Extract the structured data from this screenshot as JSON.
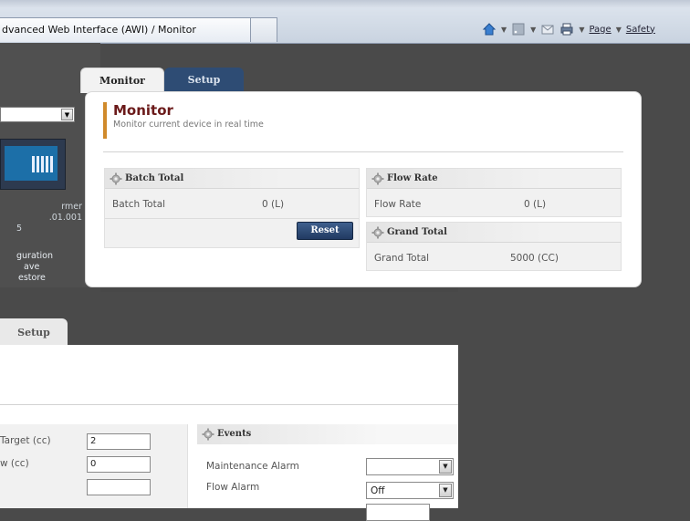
{
  "browser": {
    "tab_title": "dvanced Web Interface (AWI) / Monitor",
    "cmd_page": "Page",
    "cmd_safety": "Safety"
  },
  "left_window": {
    "lines": [
      "rmer",
      ".01.001",
      "5",
      "guration",
      "ave",
      "estore"
    ]
  },
  "monitor": {
    "tabs": [
      {
        "label": "Monitor",
        "active": true
      },
      {
        "label": "Setup",
        "active": false
      }
    ],
    "title": "Monitor",
    "subtitle": "Monitor current device in real time",
    "batch_panel": {
      "title": "Batch Total",
      "label": "Batch Total",
      "value": "0 (L)",
      "reset_label": "Reset"
    },
    "flow_panel": {
      "title": "Flow Rate",
      "label": "Flow Rate",
      "value": "0 (L)"
    },
    "grand_panel": {
      "title": "Grand Total",
      "label": "Grand Total",
      "value": "5000 (CC)"
    }
  },
  "setup": {
    "tab_label": "Setup",
    "left_rows": [
      {
        "label": "Target (cc)",
        "value": "2"
      },
      {
        "label": "w (cc)",
        "value": "0"
      }
    ],
    "events": {
      "title": "Events",
      "rows": [
        {
          "label": "Maintenance Alarm",
          "value": ""
        },
        {
          "label": "Flow Alarm",
          "value": "Off"
        }
      ]
    }
  }
}
